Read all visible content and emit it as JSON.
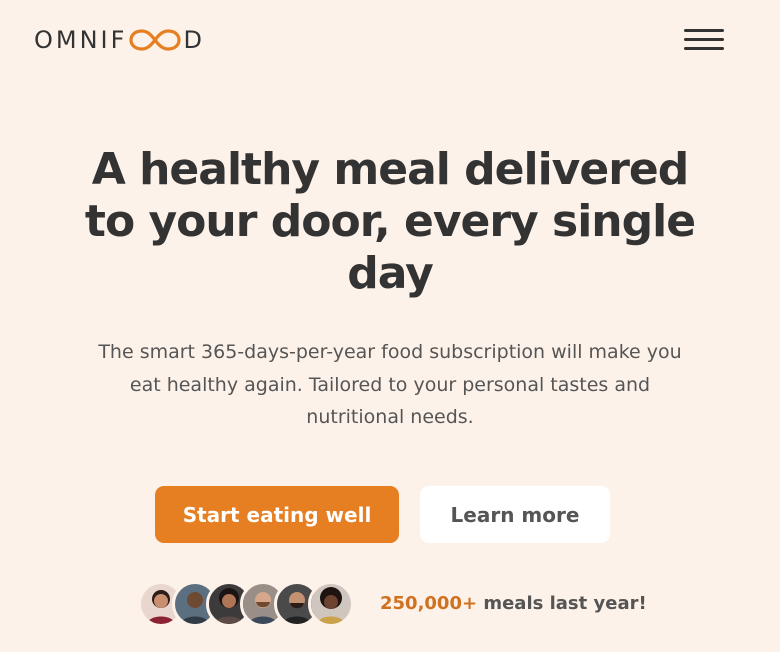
{
  "brand": {
    "name_prefix": "OMNIF",
    "name_suffix": "D",
    "accent_color": "#e67e22",
    "logo_icon": "infinity-icon"
  },
  "nav": {
    "menu_icon": "hamburger-menu-icon"
  },
  "hero": {
    "title": "A healthy meal delivered to your door, every single day",
    "description": "The smart 365-days-per-year food subscription will make you eat healthy again. Tailored to your personal tastes and nutritional needs.",
    "primary_button": "Start eating well",
    "secondary_button": "Learn more"
  },
  "customers": {
    "avatar_count": 6,
    "meals_count": "250,000+",
    "meals_label": " meals last year!"
  },
  "colors": {
    "background": "#fdf2e9",
    "primary_button": "#e67e22",
    "text": "#333333"
  }
}
